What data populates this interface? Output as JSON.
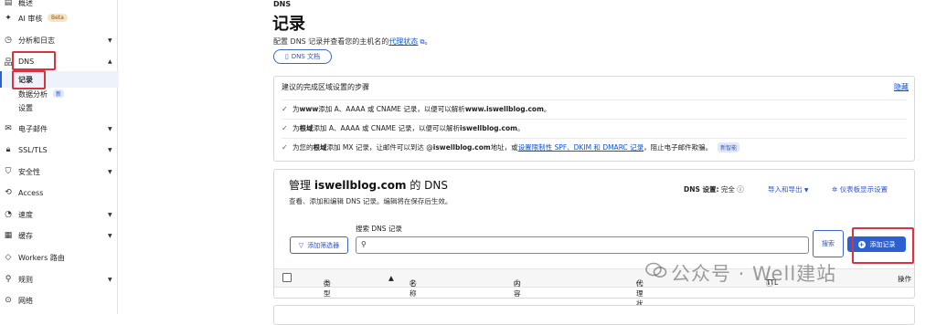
{
  "sidebar": {
    "items": [
      {
        "label": "概述",
        "icon": "overview-icon",
        "chevron": false
      },
      {
        "label": "AI 审核",
        "icon": "ai-icon",
        "badge": "Beta",
        "chevron": false
      },
      {
        "label": "分析和日志",
        "icon": "clock-icon",
        "chevron": true
      },
      {
        "label": "DNS",
        "icon": "network-icon",
        "chevron": true
      },
      {
        "label": "电子邮件",
        "icon": "mail-icon",
        "chevron": true
      },
      {
        "label": "SSL/TLS",
        "icon": "lock-icon",
        "chevron": true
      },
      {
        "label": "安全性",
        "icon": "shield-icon",
        "chevron": true
      },
      {
        "label": "Access",
        "icon": "access-icon",
        "chevron": false
      },
      {
        "label": "速度",
        "icon": "speed-icon",
        "chevron": true
      },
      {
        "label": "缓存",
        "icon": "cache-icon",
        "chevron": true
      },
      {
        "label": "Workers 路由",
        "icon": "workers-icon",
        "chevron": false
      },
      {
        "label": "规则",
        "icon": "rules-icon",
        "chevron": true
      },
      {
        "label": "网络",
        "icon": "location-icon",
        "chevron": false
      }
    ],
    "dns_sub": {
      "records": "记录",
      "analytics": "数据分析",
      "analytics_badge": "新",
      "settings": "设置"
    }
  },
  "page": {
    "crumb": "DNS",
    "title": "记录",
    "subtitle_pre": "配置 DNS 记录并查看您的主机名的",
    "subtitle_link": "代理状态",
    "subtitle_end": "。",
    "docs_button": "DNS 文档"
  },
  "setup": {
    "header": "建议的完成区域设置的步骤",
    "hide": "隐藏",
    "step1": {
      "pre": "为 ",
      "b1": "www",
      "mid": " 添加 A、AAAA 或 CNAME 记录，以便可以解析 ",
      "b2": "www.iswellblog.com",
      "end": "。"
    },
    "step2": {
      "pre": "为",
      "b1": "根域",
      "mid": "添加 A、AAAA 或 CNAME 记录，以便可以解析 ",
      "b2": "iswellblog.com",
      "end": "。"
    },
    "step3": {
      "pre": "为您的",
      "b1": "根域",
      "mid": "添加 MX 记录，让邮件可以到达 @",
      "b2": "iswellblog.com",
      "mid2": " 地址，或",
      "link": "设置限制性 SPF、DKIM 和 DMARC 记录",
      "end": "，阻止电子邮件欺骗。",
      "badge": "新智能"
    }
  },
  "manage": {
    "title_pre": "管理 ",
    "domain": "iswellblog.com",
    "title_post": " 的 DNS",
    "subtitle": "查看、添加和编辑 DNS 记录。编辑将在保存后生效。",
    "dns_settings_label": "DNS 设置:",
    "dns_settings_value": "完全",
    "import_export": "导入和导出",
    "dashboard_settings": "仪表板显示设置",
    "search_label": "搜索 DNS 记录",
    "search_placeholder": "",
    "filter_button": "添加筛选器",
    "search_button": "搜索",
    "add_button": "添加记录",
    "columns": {
      "type": "类型",
      "name": "名称",
      "content": "内容",
      "proxy": "代理状态",
      "ttl": "TTL",
      "actions": "操作"
    }
  },
  "watermark": "公众号 · Well建站",
  "colors": {
    "accent": "#2c5fd1",
    "highlight_box": "#d9333f",
    "link": "#0b55d9"
  }
}
